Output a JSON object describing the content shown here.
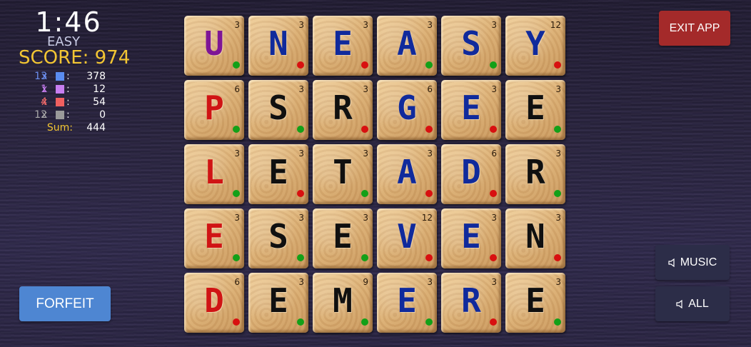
{
  "timer": "1:46",
  "difficulty": "EASY",
  "score_text": "SCORE: 974",
  "stats": [
    {
      "count": "13",
      "x": "x",
      "colon": ":",
      "value": "378",
      "color": "#5a8cf0",
      "count_color": "#6d8ff0"
    },
    {
      "count": "1",
      "x": "x",
      "colon": ":",
      "value": "12",
      "color": "#c77ef0",
      "count_color": "#c77ef0"
    },
    {
      "count": "4",
      "x": "x",
      "colon": ":",
      "value": "54",
      "color": "#f06060",
      "count_color": "#f06a6a"
    },
    {
      "count": "12",
      "x": "x",
      "colon": ":",
      "value": "0",
      "color": "#9a9a9a",
      "count_color": "#a8a8a8"
    }
  ],
  "sum": {
    "label": "Sum:",
    "value": "444"
  },
  "buttons": {
    "exit": "EXIT APP",
    "forfeit": "FORFEIT",
    "music": "MUSIC",
    "all": "ALL"
  },
  "colors": {
    "blue": "#102a9c",
    "purple": "#7e1596",
    "red": "#d01414",
    "black": "#101010",
    "dot_green": "#13a018",
    "dot_red": "#d81010"
  },
  "board": [
    [
      {
        "l": "U",
        "p": "3",
        "c": "purple",
        "d": "green"
      },
      {
        "l": "N",
        "p": "3",
        "c": "blue",
        "d": "red"
      },
      {
        "l": "E",
        "p": "3",
        "c": "blue",
        "d": "red"
      },
      {
        "l": "A",
        "p": "3",
        "c": "blue",
        "d": "green"
      },
      {
        "l": "S",
        "p": "3",
        "c": "blue",
        "d": "green"
      },
      {
        "l": "Y",
        "p": "12",
        "c": "blue",
        "d": "red"
      }
    ],
    [
      {
        "l": "P",
        "p": "6",
        "c": "red",
        "d": "green"
      },
      {
        "l": "S",
        "p": "3",
        "c": "black",
        "d": "green"
      },
      {
        "l": "R",
        "p": "3",
        "c": "black",
        "d": "red"
      },
      {
        "l": "G",
        "p": "6",
        "c": "blue",
        "d": "red"
      },
      {
        "l": "E",
        "p": "3",
        "c": "blue",
        "d": "red"
      },
      {
        "l": "E",
        "p": "3",
        "c": "black",
        "d": "green"
      }
    ],
    [
      {
        "l": "L",
        "p": "3",
        "c": "red",
        "d": "green"
      },
      {
        "l": "E",
        "p": "3",
        "c": "black",
        "d": "red"
      },
      {
        "l": "T",
        "p": "3",
        "c": "black",
        "d": "green"
      },
      {
        "l": "A",
        "p": "3",
        "c": "blue",
        "d": "red"
      },
      {
        "l": "D",
        "p": "6",
        "c": "blue",
        "d": "red"
      },
      {
        "l": "R",
        "p": "3",
        "c": "black",
        "d": "green"
      }
    ],
    [
      {
        "l": "E",
        "p": "3",
        "c": "red",
        "d": "green"
      },
      {
        "l": "S",
        "p": "3",
        "c": "black",
        "d": "green"
      },
      {
        "l": "E",
        "p": "3",
        "c": "black",
        "d": "green"
      },
      {
        "l": "V",
        "p": "12",
        "c": "blue",
        "d": "red"
      },
      {
        "l": "E",
        "p": "3",
        "c": "blue",
        "d": "red"
      },
      {
        "l": "N",
        "p": "3",
        "c": "black",
        "d": "red"
      }
    ],
    [
      {
        "l": "D",
        "p": "6",
        "c": "red",
        "d": "red"
      },
      {
        "l": "E",
        "p": "3",
        "c": "black",
        "d": "green"
      },
      {
        "l": "M",
        "p": "9",
        "c": "black",
        "d": "green"
      },
      {
        "l": "E",
        "p": "3",
        "c": "blue",
        "d": "green"
      },
      {
        "l": "R",
        "p": "3",
        "c": "blue",
        "d": "red"
      },
      {
        "l": "E",
        "p": "3",
        "c": "black",
        "d": "green"
      }
    ]
  ]
}
